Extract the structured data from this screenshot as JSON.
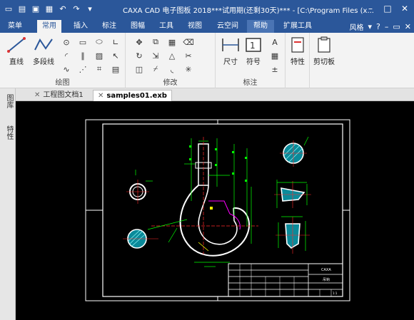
{
  "window": {
    "title": "CAXA CAD 电子图板 2018***试用期(还剩30天)*** - [C:\\Program Files (x..."
  },
  "quick_access": [
    "new-icon",
    "open-icon",
    "save-icon",
    "print-icon",
    "undo-icon",
    "redo-icon"
  ],
  "tabs": {
    "menu": "菜单",
    "home": "常用",
    "insert": "插入",
    "annotate": "标注",
    "sheet": "图幅",
    "tools": "工具",
    "view": "视图",
    "cloud": "云空间",
    "help": "帮助",
    "ext": "扩展工具",
    "style": "风格"
  },
  "ribbon": {
    "draw": {
      "label": "绘图",
      "line": "直线",
      "polyline": "多段线"
    },
    "modify": {
      "label": "修改"
    },
    "dimension": {
      "label": "标注",
      "size": "尺寸",
      "symbol": "符号"
    },
    "props": {
      "label": "特性"
    },
    "clipboard": {
      "label": "剪切板"
    }
  },
  "side_panels": {
    "library": "图库",
    "properties": "特性"
  },
  "doc_tabs": {
    "tab1": "工程图文档1",
    "tab2": "samples01.exb"
  },
  "drawing": {
    "title_cell": "CAXA",
    "part_cell": "吊钩",
    "scale_cell": "1:1",
    "colors": {
      "frame": "#ffffff",
      "dim": "#00ff00",
      "center": "#ff2a2a",
      "hatch": "#00cccc",
      "accent": "#ff00ff",
      "yellow": "#ffff00"
    }
  }
}
